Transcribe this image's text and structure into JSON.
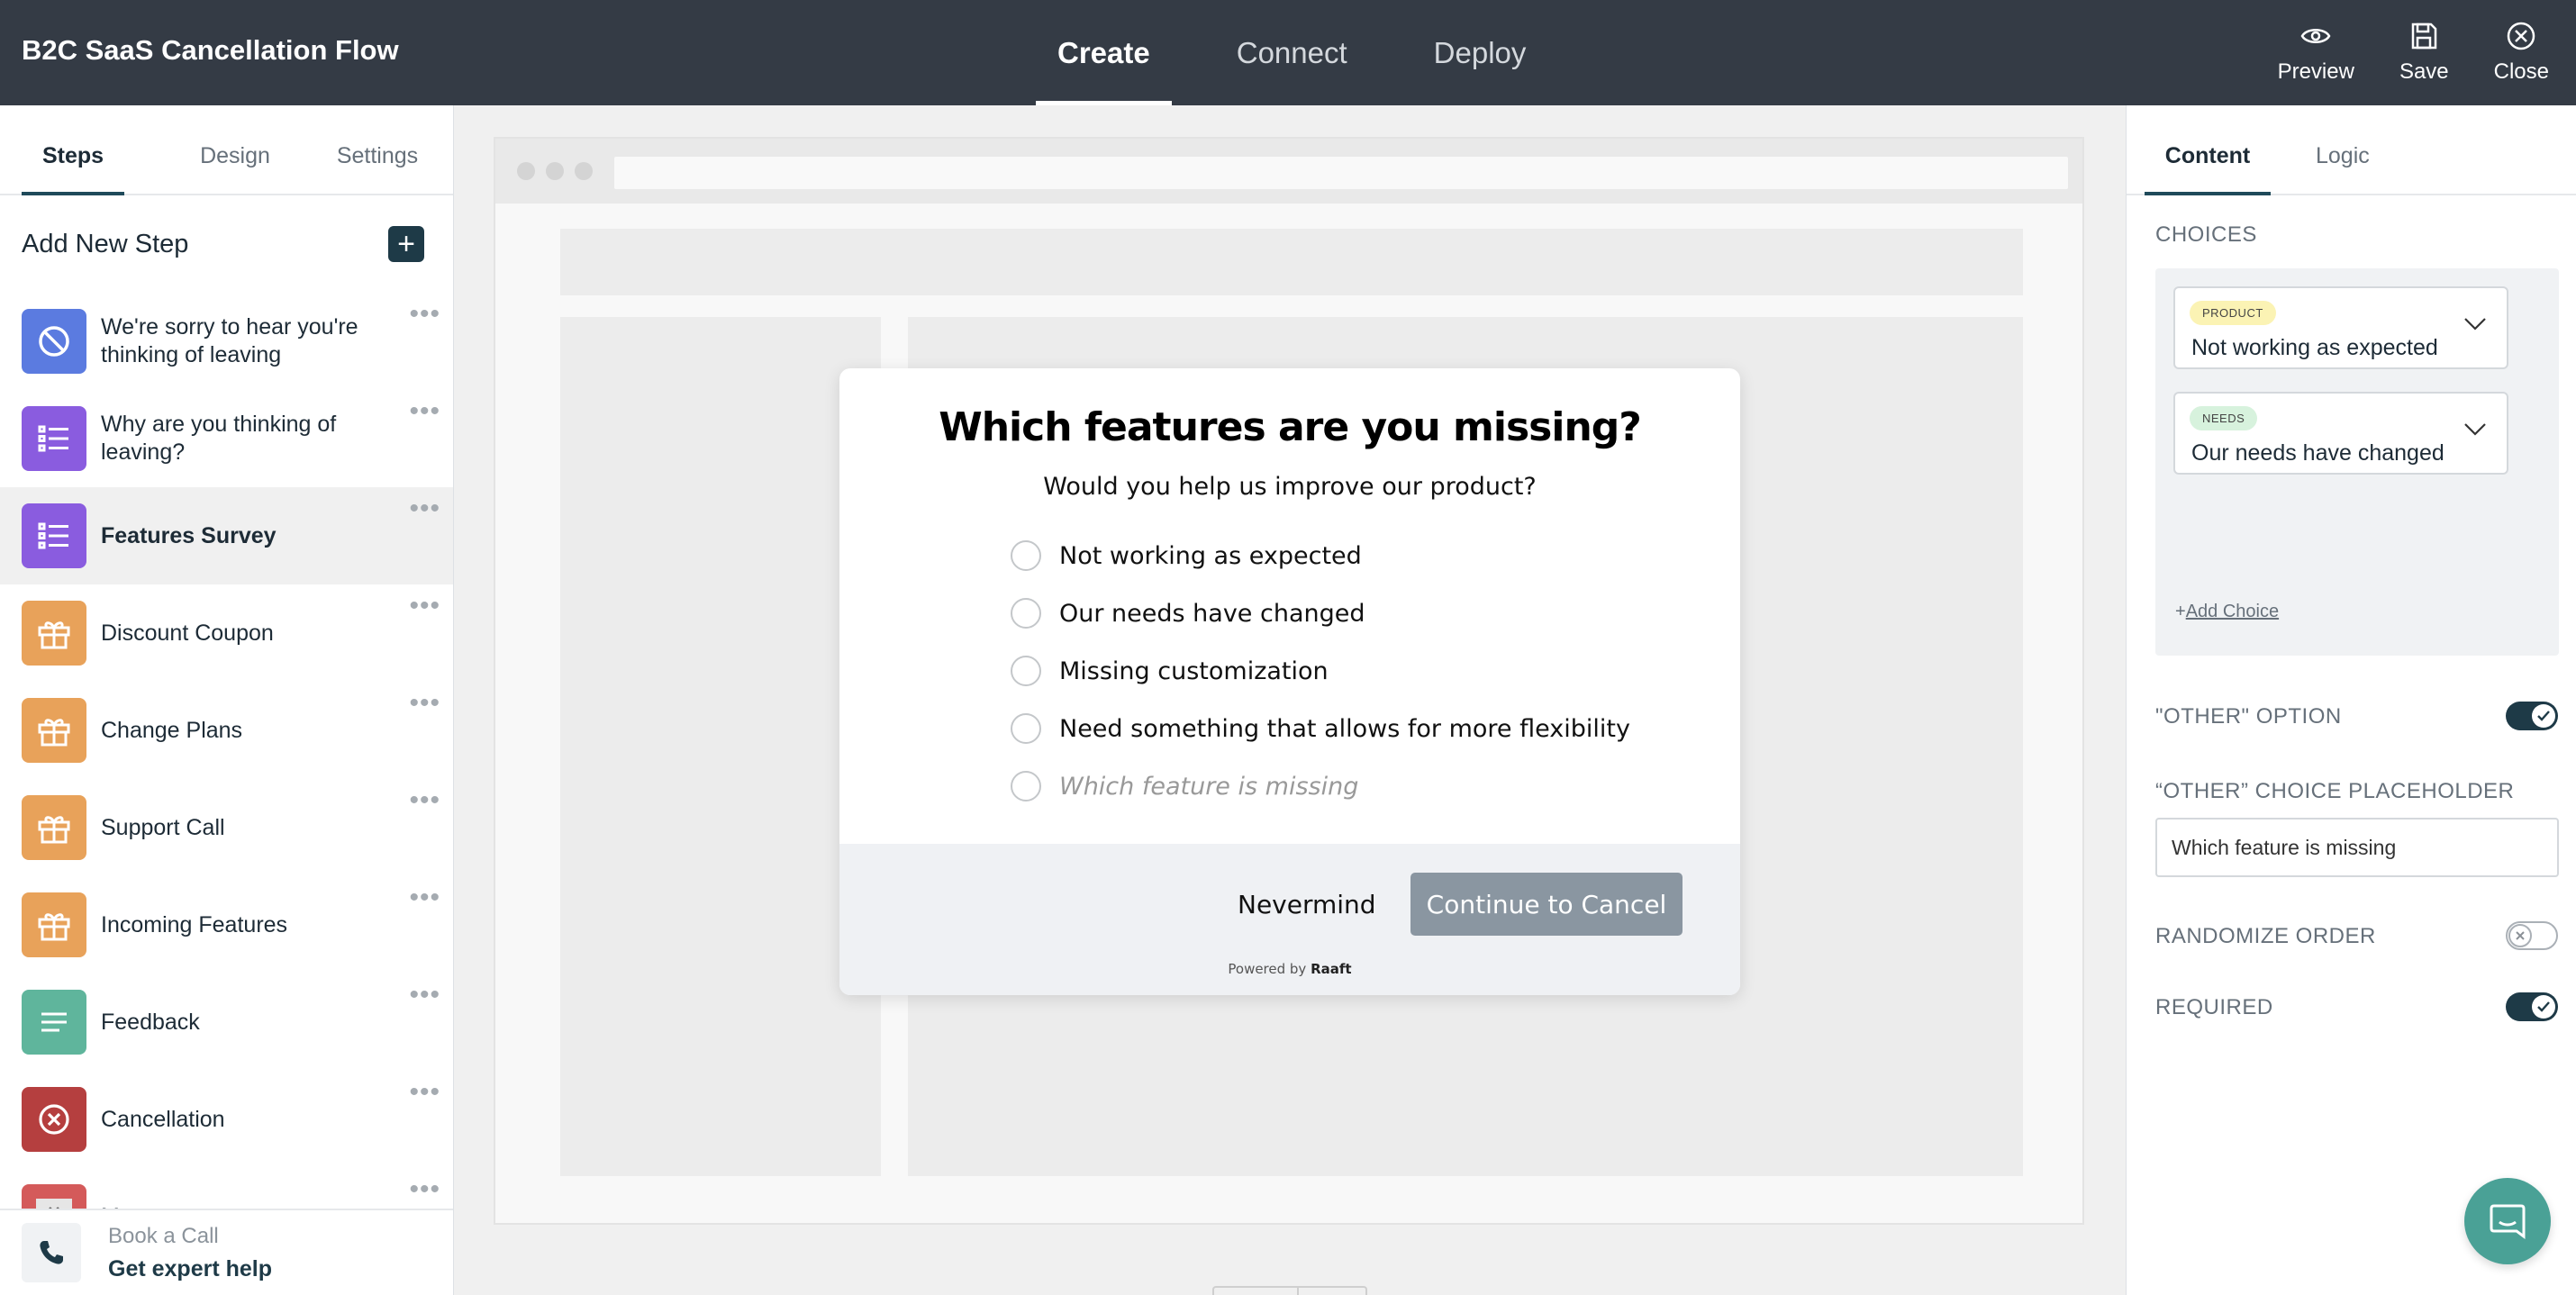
{
  "app": {
    "title": "B2C SaaS Cancellation Flow"
  },
  "main_tabs": [
    {
      "label": "Create",
      "active": true
    },
    {
      "label": "Connect",
      "active": false
    },
    {
      "label": "Deploy",
      "active": false
    }
  ],
  "top_actions": {
    "preview": "Preview",
    "save": "Save",
    "close": "Close"
  },
  "sidebar": {
    "tabs": [
      "Steps",
      "Design",
      "Settings"
    ],
    "add_step_label": "Add New Step",
    "steps": [
      {
        "label": "We're sorry to hear you're thinking of leaving",
        "icon": "ban-icon",
        "color": "#5b7be0"
      },
      {
        "label": "Why are you thinking of leaving?",
        "icon": "list-icon",
        "color": "#8a5cdf"
      },
      {
        "label": "Features Survey",
        "icon": "list-icon",
        "color": "#8a5cdf",
        "active": true
      },
      {
        "label": "Discount Coupon",
        "icon": "gift-icon",
        "color": "#e8a25a"
      },
      {
        "label": "Change Plans",
        "icon": "gift-icon",
        "color": "#e8a25a"
      },
      {
        "label": "Support Call",
        "icon": "gift-icon",
        "color": "#e8a25a"
      },
      {
        "label": "Incoming Features",
        "icon": "gift-icon",
        "color": "#e8a25a"
      },
      {
        "label": "Feedback",
        "icon": "text-lines-icon",
        "color": "#5fb59c"
      },
      {
        "label": "Cancellation",
        "icon": "x-circle-icon",
        "color": "#b53f3f"
      },
      {
        "label": "Message",
        "icon": "chevron-down-icon",
        "color": "#d45a5a"
      }
    ],
    "book_call": {
      "subtitle": "Book a Call",
      "title": "Get expert help"
    }
  },
  "modal": {
    "title": "Which features are you missing?",
    "subtitle": "Would you help us improve our product?",
    "options": [
      "Not working as expected",
      "Our needs have changed",
      "Missing customization",
      "Need something that allows for more flexibility"
    ],
    "other_placeholder": "Which feature is missing",
    "nevermind": "Nevermind",
    "continue": "Continue to Cancel",
    "powered_by_prefix": "Powered by",
    "powered_by_brand": "Raaft"
  },
  "right_panel": {
    "tabs": [
      "Content",
      "Logic"
    ],
    "choices_heading": "CHOICES",
    "choices": [
      {
        "tag": "PRODUCT",
        "tag_color": "#fbf3b4",
        "value": "Not working as expected"
      },
      {
        "tag": "NEEDS",
        "tag_color": "#d7f2dd",
        "value": "Our needs have changed"
      }
    ],
    "add_choice_plus": "+",
    "add_choice": "Add Choice",
    "other_option_label": "\"OTHER\" OPTION",
    "other_option_on": true,
    "other_placeholder_label": "“OTHER” CHOICE PLACEHOLDER",
    "other_placeholder_value": "Which feature is missing",
    "randomize_label": "RANDOMIZE ORDER",
    "randomize_on": false,
    "required_label": "REQUIRED",
    "required_on": true
  },
  "colors": {
    "topbar": "#343b45",
    "accent_dark": "#1e3a47",
    "continue_button": "#8a96a1",
    "chat_button": "#4aa196"
  }
}
